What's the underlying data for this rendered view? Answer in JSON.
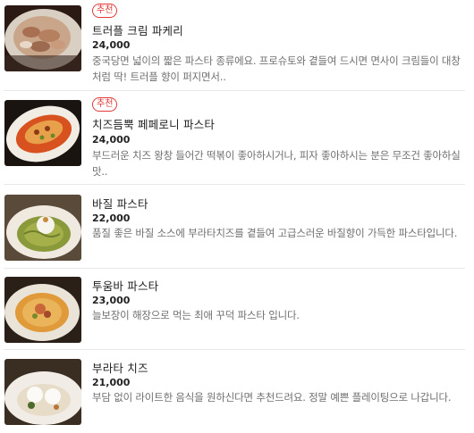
{
  "menu": {
    "items": [
      {
        "badge": "추천",
        "name": "트러플 크림 파케리",
        "price": "24,000",
        "description": "중국당면 넓이의 짧은 파스타 종류에요. 프로슈토와 곁들여 드시면 면사이 크림들이 대창처럼 딱! 트러플 향이 퍼지면서..",
        "image": "creamy-paccheri-dish"
      },
      {
        "badge": "추천",
        "name": "치즈듬뿍 페페로니 파스타",
        "price": "24,000",
        "description": "부드러운 치즈 왕창 들어간 떡볶이 좋아하시거나, 피자 좋아하시는 분은 무조건 좋아하실 맛..",
        "image": "pepperoni-cheese-pasta"
      },
      {
        "badge": "",
        "name": "바질 파스타",
        "price": "22,000",
        "description": "품질 좋은 바질 소스에 부라타치즈를 곁들여 고급스러운 바질향이 가득한 파스타입니다.",
        "image": "basil-pasta-burrata"
      },
      {
        "badge": "",
        "name": "투움바 파스타",
        "price": "23,000",
        "description": "늘보장이 해장으로 먹는 최애 꾸덕 파스타 입니다.",
        "image": "toowoomba-pasta"
      },
      {
        "badge": "",
        "name": "부라타 치즈",
        "price": "21,000",
        "description": "부담 없이 라이트한 음식을 원하신다면 추천드려요. 정말 예쁜 플레이팅으로 나갑니다.",
        "image": "burrata-cheese-plate"
      }
    ]
  },
  "colors": {
    "badge": "#e03a3a",
    "description": "#6f6f6f",
    "separator": "#e9e9e9"
  }
}
